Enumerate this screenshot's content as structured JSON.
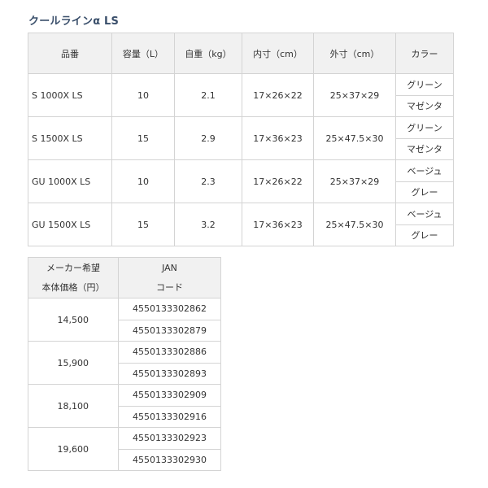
{
  "title": "クールラインα LS",
  "spec_table": {
    "headers": [
      "品番",
      "容量（L）",
      "自重（kg）",
      "内寸（cm）",
      "外寸（cm）",
      "カラー"
    ],
    "rows": [
      {
        "model": "S 1000X LS",
        "capacity": "10",
        "weight": "2.1",
        "inner": "17×26×22",
        "outer": "25×37×29",
        "colors": [
          "グリーン",
          "マゼンタ"
        ]
      },
      {
        "model": "S 1500X LS",
        "capacity": "15",
        "weight": "2.9",
        "inner": "17×36×23",
        "outer": "25×47.5×30",
        "colors": [
          "グリーン",
          "マゼンタ"
        ]
      },
      {
        "model": "GU 1000X LS",
        "capacity": "10",
        "weight": "2.3",
        "inner": "17×26×22",
        "outer": "25×37×29",
        "colors": [
          "ベージュ",
          "グレー"
        ]
      },
      {
        "model": "GU 1500X LS",
        "capacity": "15",
        "weight": "3.2",
        "inner": "17×36×23",
        "outer": "25×47.5×30",
        "colors": [
          "ベージュ",
          "グレー"
        ]
      }
    ]
  },
  "price_table": {
    "header_price_line1": "メーカー希望",
    "header_price_line2": "本体価格（円）",
    "header_jan_line1": "JAN",
    "header_jan_line2": "コード",
    "rows": [
      {
        "price": "14,500",
        "jan": [
          "4550133302862",
          "4550133302879"
        ]
      },
      {
        "price": "15,900",
        "jan": [
          "4550133302886",
          "4550133302893"
        ]
      },
      {
        "price": "18,100",
        "jan": [
          "4550133302909",
          "4550133302916"
        ]
      },
      {
        "price": "19,600",
        "jan": [
          "4550133302923",
          "4550133302930"
        ]
      }
    ]
  }
}
